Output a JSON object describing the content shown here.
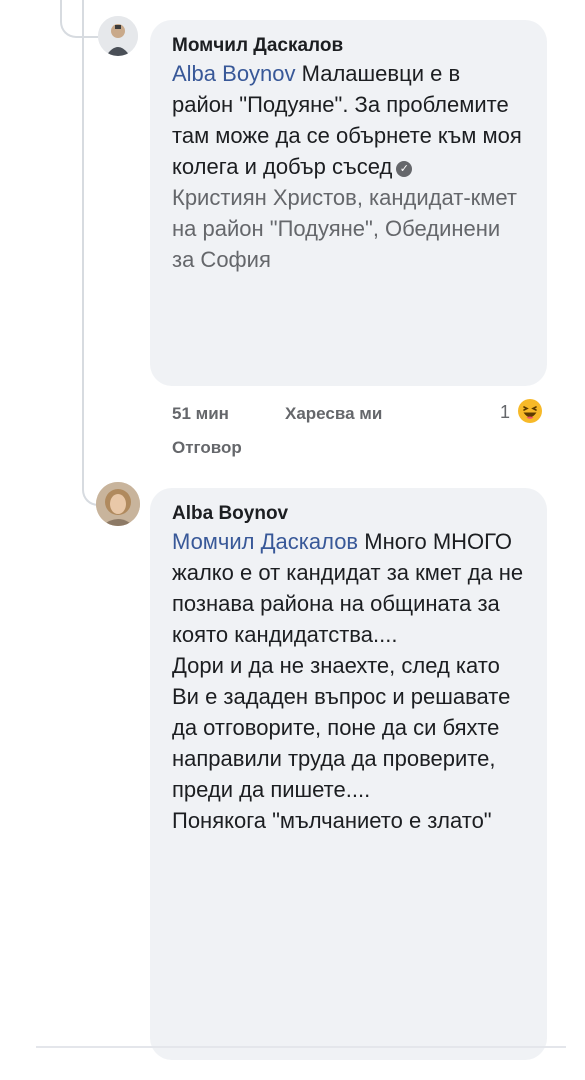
{
  "comments": [
    {
      "author": "Момчил Даскалов",
      "mention": "Alba Boynov",
      "text_main": " Малашевци е в район \"Подуяне\". За проблемите там може да се обърнете към моя колега и добър съсед",
      "text_muted": "Кристиян Христов, кандидат-кмет на район \"Подуяне\", Обединени за София",
      "time": "51 мин",
      "like_label": "Харесва ми",
      "reply_label": "Отговор",
      "reaction_count": "1",
      "reaction_icon": "haha-emoji-icon",
      "verified_icon": "verified-badge-icon"
    },
    {
      "author": "Alba Boynov",
      "mention": "Момчил Даскалов",
      "text_main": " Много МНОГО жалко е от кандидат за кмет да не познава района на общината за която кандидатства....\nДори и да не знаехте, след като Ви е зададен въпрос и решавате да отговорите, поне да си бяхте направили труда да проверите, преди да пишете....\nПонякога \"мълчанието е злато\""
    }
  ],
  "colors": {
    "bubble": "#f0f2f5",
    "mention": "#385898",
    "muted": "#65676b"
  }
}
